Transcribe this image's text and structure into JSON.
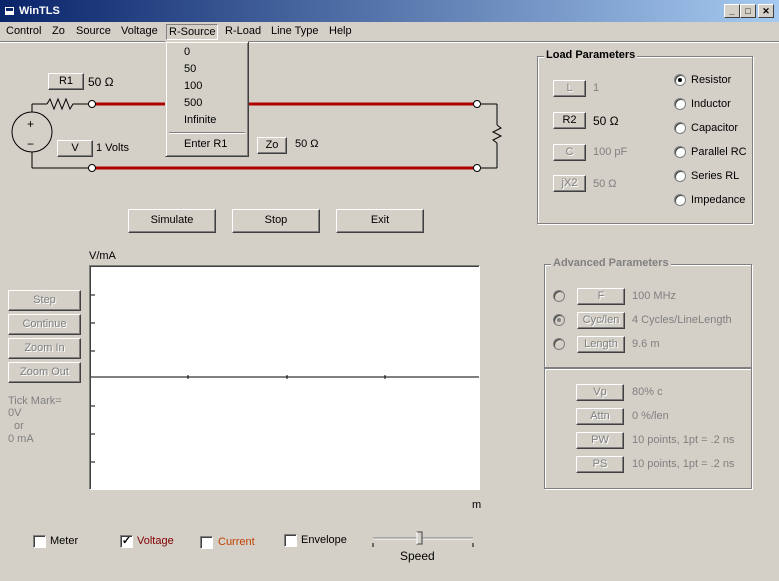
{
  "window": {
    "title": "WinTLS"
  },
  "caption_buttons": {
    "minimize": "_",
    "maximize": "□",
    "close": "✕"
  },
  "menu": {
    "items": [
      "Control",
      "Zo",
      "Source",
      "Voltage",
      "R-Source",
      "R-Load",
      "Line Type",
      "Help"
    ],
    "open_index": 4
  },
  "dropdown": {
    "items": [
      "0",
      "50",
      "100",
      "500",
      "Infinite"
    ],
    "extra": "Enter R1"
  },
  "circuit": {
    "r1_button": "R1",
    "r1_value": "50 Ω",
    "v_button": "V",
    "v_value": "1 Volts",
    "zo_button": "Zo",
    "zo_value": "50 Ω",
    "source_plus": "+",
    "source_minus": "−",
    "line_color": "#b00000"
  },
  "actions": {
    "simulate": "Simulate",
    "stop": "Stop",
    "exit": "Exit"
  },
  "load_params": {
    "title": "Load Parameters",
    "rows": [
      {
        "button": "L",
        "value": "1",
        "enabled": false
      },
      {
        "button": "R2",
        "value": "50 Ω",
        "enabled": true
      },
      {
        "button": "C",
        "value": "100 pF",
        "enabled": false
      },
      {
        "button": "jX2",
        "value": "50 Ω",
        "enabled": false
      }
    ],
    "radios": [
      "Resistor",
      "Inductor",
      "Capacitor",
      "Parallel RC",
      "Series RL",
      "Impedance"
    ],
    "selected_radio": 0
  },
  "advanced": {
    "title": "Advanced Parameters",
    "rows": [
      {
        "button": "F",
        "value": "100 MHz"
      },
      {
        "button": "Cyc/len",
        "value": "4 Cycles/LineLength"
      },
      {
        "button": "Length",
        "value": "9.6 m"
      }
    ],
    "selected_radio": 1,
    "rows2": [
      {
        "button": "Vp",
        "value": "80% c"
      },
      {
        "button": "Attn",
        "value": "0 %/len"
      },
      {
        "button": "PW",
        "value": "10 points, 1pt = .2 ns"
      },
      {
        "button": "PS",
        "value": "10 points, 1pt = .2 ns"
      }
    ]
  },
  "side_buttons": [
    "Step",
    "Continue",
    "Zoom In",
    "Zoom Out"
  ],
  "tick_mark": [
    "Tick Mark=",
    "0V",
    "or",
    "0 mA"
  ],
  "plot": {
    "y_label": "V/mA",
    "x_label": "m"
  },
  "bottom": {
    "meter": "Meter",
    "voltage": "Voltage",
    "current": "Current",
    "envelope": "Envelope",
    "speed": "Speed",
    "voltage_checked": true,
    "meter_checked": false,
    "current_checked": false,
    "envelope_checked": false,
    "voltage_color": "#800000",
    "current_color": "#c04000"
  }
}
